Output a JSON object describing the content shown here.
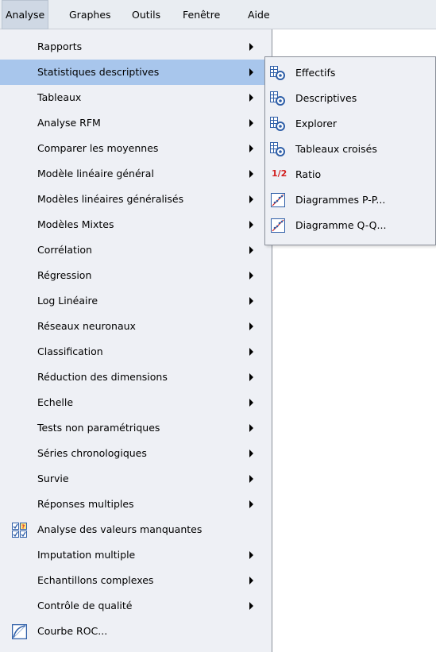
{
  "menubar": {
    "items": [
      {
        "label": "Analyse"
      },
      {
        "label": "Graphes"
      },
      {
        "label": "Outils"
      },
      {
        "label": "Fenêtre"
      },
      {
        "label": "Aide"
      }
    ]
  },
  "analyse_menu": {
    "items": [
      {
        "label": "Rapports",
        "submenu": true
      },
      {
        "label": "Statistiques descriptives",
        "submenu": true,
        "selected": true
      },
      {
        "label": "Tableaux",
        "submenu": true
      },
      {
        "label": "Analyse RFM",
        "submenu": true
      },
      {
        "label": "Comparer les moyennes",
        "submenu": true
      },
      {
        "label": "Modèle linéaire général",
        "submenu": true
      },
      {
        "label": "Modèles linéaires généralisés",
        "submenu": true
      },
      {
        "label": "Modèles Mixtes",
        "submenu": true
      },
      {
        "label": "Corrélation",
        "submenu": true
      },
      {
        "label": "Régression",
        "submenu": true
      },
      {
        "label": "Log Linéaire",
        "submenu": true
      },
      {
        "label": "Réseaux neuronaux",
        "submenu": true
      },
      {
        "label": "Classification",
        "submenu": true
      },
      {
        "label": "Réduction des dimensions",
        "submenu": true
      },
      {
        "label": "Echelle",
        "submenu": true
      },
      {
        "label": "Tests non paramétriques",
        "submenu": true
      },
      {
        "label": "Séries chronologiques",
        "submenu": true
      },
      {
        "label": "Survie",
        "submenu": true
      },
      {
        "label": "Réponses multiples",
        "submenu": true
      },
      {
        "label": "Analyse des valeurs manquantes",
        "submenu": false,
        "icon": "missing-values-icon"
      },
      {
        "label": "Imputation multiple",
        "submenu": true
      },
      {
        "label": "Echantillons complexes",
        "submenu": true
      },
      {
        "label": "Contrôle de qualité",
        "submenu": true
      },
      {
        "label": "Courbe ROC...",
        "submenu": false,
        "icon": "roc-curve-icon"
      }
    ]
  },
  "descriptives_submenu": {
    "items": [
      {
        "label": "Effectifs",
        "icon": "frequency-table-icon"
      },
      {
        "label": "Descriptives",
        "icon": "frequency-table-icon"
      },
      {
        "label": "Explorer",
        "icon": "frequency-table-icon"
      },
      {
        "label": "Tableaux croisés",
        "icon": "frequency-table-icon"
      },
      {
        "label": "Ratio",
        "icon": "ratio-icon",
        "glyph": "1/2"
      },
      {
        "label": "Diagrammes P-P...",
        "icon": "pp-plot-icon"
      },
      {
        "label": "Diagramme Q-Q...",
        "icon": "qq-plot-icon"
      }
    ]
  },
  "colors": {
    "menu_bg": "#eef0f5",
    "selected_bg": "#a8c6ec",
    "ratio_red": "#d21f1f",
    "icon_blue": "#2f5fa8"
  }
}
